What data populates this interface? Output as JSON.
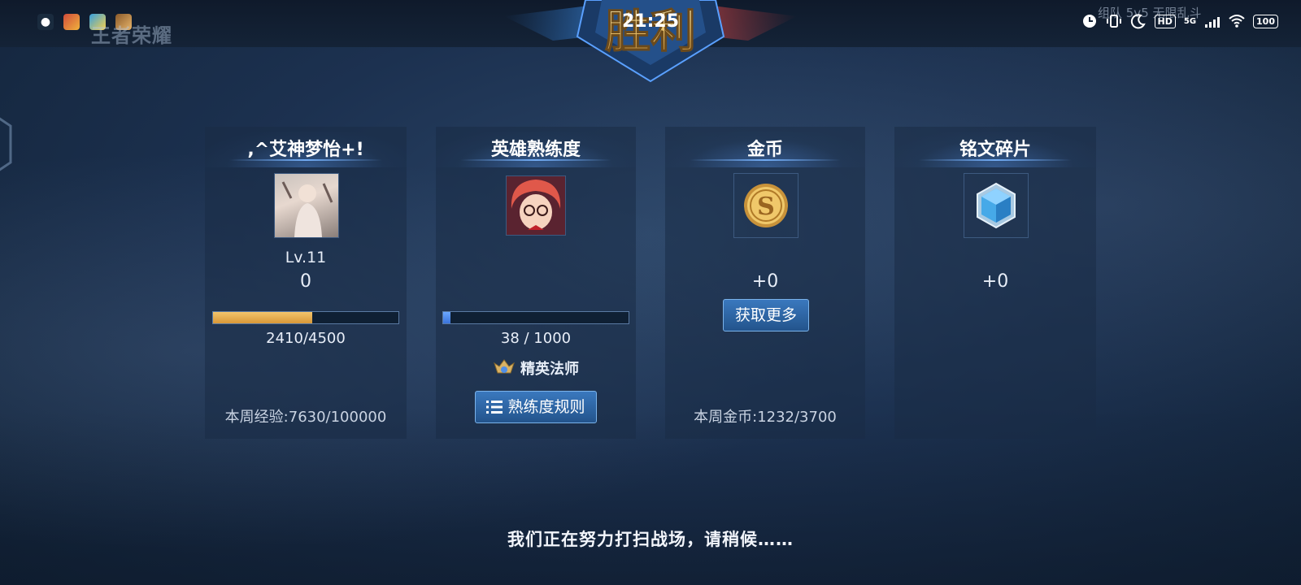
{
  "status_bar": {
    "time": "21:25",
    "battery": "100",
    "network": "5G",
    "hd_label": "HD"
  },
  "header": {
    "logo_text": "王者荣耀",
    "victory_label": "胜利",
    "mode_text": "组队 5v5 无限乱斗"
  },
  "player_panel": {
    "title": ",^艾神梦怡+!",
    "level": "Lv.11",
    "exp_gain": "0",
    "progress_text": "2410/4500",
    "progress_fraction": 0.536,
    "weekly_exp": "本周经验:7630/100000"
  },
  "hero_panel": {
    "title": "英雄熟练度",
    "progress_text": "38 / 1000",
    "progress_fraction": 0.038,
    "rank_label": "精英法师",
    "rules_button": "熟练度规则"
  },
  "gold_panel": {
    "title": "金币",
    "gain": "+0",
    "get_more_button": "获取更多",
    "weekly_gold": "本周金币:1232/3700"
  },
  "inscription_panel": {
    "title": "铭文碎片",
    "gain": "+0"
  },
  "footer": {
    "message": "我们正在努力打扫战场，请稍候……"
  },
  "colors": {
    "exp_bar": "#e8b056",
    "proficiency_bar": "#3f7ee6",
    "button_bg": "#2f6aa8"
  }
}
